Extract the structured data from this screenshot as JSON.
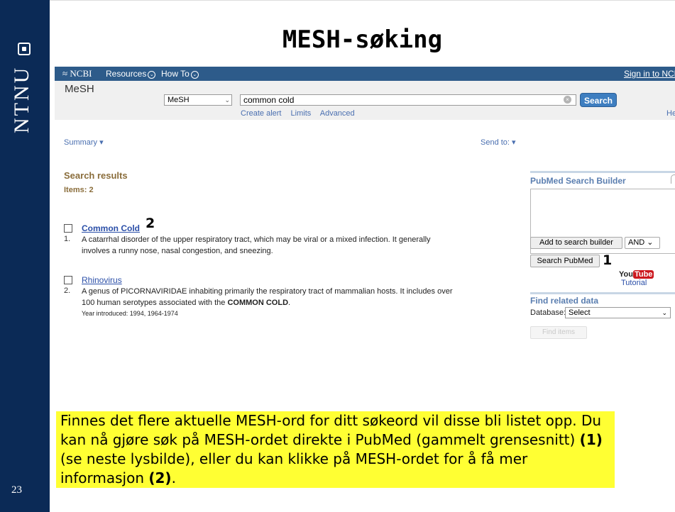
{
  "slide": {
    "title": "MESH-søking",
    "logo_text": "NTNU",
    "page_number": "23"
  },
  "ncbi_header": {
    "logo": "NCBI",
    "resources": "Resources",
    "howto": "How To",
    "signin": "Sign in to NCBI",
    "bar_color": "#2d5b8a"
  },
  "search": {
    "db_label": "MeSH",
    "db_select": "MeSH",
    "term": "common cold",
    "search_button": "Search",
    "links": [
      "Create alert",
      "Limits",
      "Advanced"
    ],
    "help": "Help"
  },
  "results_header": {
    "summary": "Summary",
    "send_to": "Send to:"
  },
  "results": {
    "title": "Search results",
    "items": "Items: 2",
    "list": [
      {
        "num": "1.",
        "title": "Common Cold",
        "annotation": "2",
        "desc_line1": "A catarrhal disorder of the upper respiratory tract, which may be viral or a mixed infection. It generally",
        "desc_line2": "involves a runny nose, nasal congestion, and sneezing."
      },
      {
        "num": "2.",
        "title": "Rhinovirus",
        "desc_line1": "A genus of PICORNAVIRIDAE inhabiting primarily the respiratory tract of mammalian hosts. It includes over",
        "desc_line2_pre": "100 human serotypes associated with the ",
        "desc_line2_bold": "COMMON COLD",
        "desc_line2_post": ".",
        "year": "Year introduced: 1994, 1964-1974"
      }
    ]
  },
  "right_col": {
    "builder_title": "PubMed Search Builder",
    "add_button": "Add to search builder",
    "and_select": "AND",
    "search_pubmed": "Search PubMed",
    "search_pubmed_annotation": "1",
    "youtube_you": "You",
    "youtube_tube": "Tube",
    "tutorial": "Tutorial",
    "related_title": "Find related data",
    "database_label": "Database:",
    "database_select": "Select",
    "find_items": "Find items"
  },
  "explanation": {
    "part1": "Finnes det flere aktuelle MESH-ord for ditt søkeord vil disse bli listet opp. Du kan nå gjøre søk på MESH-ordet direkte i PubMed (gammelt grensesnitt) ",
    "bold1": "(1)",
    "part2": " (se neste lysbilde), eller du kan klikke på MESH-ordet for å få mer informasjon ",
    "bold2": "(2)",
    "part3": ".",
    "highlight_color": "#ffff33"
  }
}
